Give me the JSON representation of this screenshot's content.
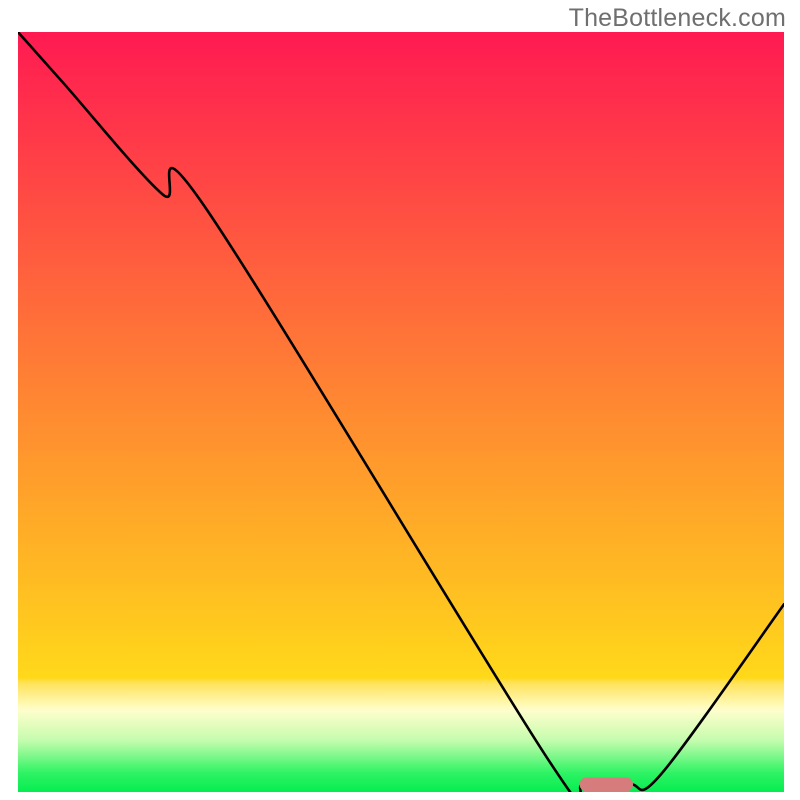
{
  "watermark": "TheBottleneck.com",
  "chart_data": {
    "type": "line",
    "title": "",
    "xlabel": "",
    "ylabel": "",
    "xlim": [
      0,
      10
    ],
    "ylim": [
      0,
      10
    ],
    "x": [
      0.0,
      0.6,
      1.88,
      2.46,
      6.9,
      7.38,
      7.98,
      8.4,
      10.0
    ],
    "y": [
      10.0,
      9.32,
      7.87,
      7.67,
      0.46,
      0.1,
      0.1,
      0.24,
      2.47
    ],
    "marker": {
      "x_center": 7.68,
      "y_center": 0.1,
      "width": 0.7,
      "height": 0.18,
      "color_hex": "#d77c7c"
    },
    "gradient_stops": [
      {
        "offset": 0.0,
        "color": "#ff1a52"
      },
      {
        "offset": 0.01,
        "color": "#ff1c51"
      },
      {
        "offset": 0.019,
        "color": "#ff1e51"
      },
      {
        "offset": 0.029,
        "color": "#ff2050"
      },
      {
        "offset": 0.039,
        "color": "#ff234f"
      },
      {
        "offset": 0.048,
        "color": "#ff254f"
      },
      {
        "offset": 0.058,
        "color": "#ff274e"
      },
      {
        "offset": 0.068,
        "color": "#ff294d"
      },
      {
        "offset": 0.077,
        "color": "#ff2b4d"
      },
      {
        "offset": 0.087,
        "color": "#ff2d4c"
      },
      {
        "offset": 0.097,
        "color": "#ff304c"
      },
      {
        "offset": 0.106,
        "color": "#ff324b"
      },
      {
        "offset": 0.116,
        "color": "#ff344a"
      },
      {
        "offset": 0.126,
        "color": "#ff364a"
      },
      {
        "offset": 0.135,
        "color": "#ff3849"
      },
      {
        "offset": 0.145,
        "color": "#ff3a48"
      },
      {
        "offset": 0.155,
        "color": "#ff3d48"
      },
      {
        "offset": 0.164,
        "color": "#ff3f47"
      },
      {
        "offset": 0.174,
        "color": "#ff4146"
      },
      {
        "offset": 0.184,
        "color": "#ff4346"
      },
      {
        "offset": 0.193,
        "color": "#ff4545"
      },
      {
        "offset": 0.203,
        "color": "#ff4745"
      },
      {
        "offset": 0.213,
        "color": "#ff4a44"
      },
      {
        "offset": 0.222,
        "color": "#ff4c43"
      },
      {
        "offset": 0.232,
        "color": "#ff4e43"
      },
      {
        "offset": 0.242,
        "color": "#ff5042"
      },
      {
        "offset": 0.251,
        "color": "#ff5241"
      },
      {
        "offset": 0.261,
        "color": "#ff5441"
      },
      {
        "offset": 0.271,
        "color": "#ff5740"
      },
      {
        "offset": 0.28,
        "color": "#ff593f"
      },
      {
        "offset": 0.29,
        "color": "#ff5b3f"
      },
      {
        "offset": 0.3,
        "color": "#ff5d3e"
      },
      {
        "offset": 0.309,
        "color": "#ff5f3e"
      },
      {
        "offset": 0.319,
        "color": "#ff613d"
      },
      {
        "offset": 0.329,
        "color": "#ff643c"
      },
      {
        "offset": 0.338,
        "color": "#ff663c"
      },
      {
        "offset": 0.348,
        "color": "#ff683b"
      },
      {
        "offset": 0.358,
        "color": "#ff6a3a"
      },
      {
        "offset": 0.367,
        "color": "#ff6c3a"
      },
      {
        "offset": 0.377,
        "color": "#ff6e39"
      },
      {
        "offset": 0.387,
        "color": "#ff7138"
      },
      {
        "offset": 0.396,
        "color": "#ff7338"
      },
      {
        "offset": 0.406,
        "color": "#ff7537"
      },
      {
        "offset": 0.415,
        "color": "#ff7737"
      },
      {
        "offset": 0.425,
        "color": "#ff7936"
      },
      {
        "offset": 0.435,
        "color": "#ff7b35"
      },
      {
        "offset": 0.444,
        "color": "#ff7e35"
      },
      {
        "offset": 0.454,
        "color": "#ff8034"
      },
      {
        "offset": 0.464,
        "color": "#ff8233"
      },
      {
        "offset": 0.473,
        "color": "#ff8433"
      },
      {
        "offset": 0.483,
        "color": "#ff8632"
      },
      {
        "offset": 0.493,
        "color": "#ff8831"
      },
      {
        "offset": 0.502,
        "color": "#ff8b31"
      },
      {
        "offset": 0.512,
        "color": "#ff8d30"
      },
      {
        "offset": 0.522,
        "color": "#ff8f30"
      },
      {
        "offset": 0.531,
        "color": "#ff912f"
      },
      {
        "offset": 0.541,
        "color": "#ff932e"
      },
      {
        "offset": 0.551,
        "color": "#ff952e"
      },
      {
        "offset": 0.56,
        "color": "#ff982d"
      },
      {
        "offset": 0.57,
        "color": "#ff9a2c"
      },
      {
        "offset": 0.58,
        "color": "#ff9c2c"
      },
      {
        "offset": 0.589,
        "color": "#ff9e2b"
      },
      {
        "offset": 0.599,
        "color": "#ffa02a"
      },
      {
        "offset": 0.609,
        "color": "#ffa22a"
      },
      {
        "offset": 0.618,
        "color": "#ffa529"
      },
      {
        "offset": 0.628,
        "color": "#ffa729"
      },
      {
        "offset": 0.638,
        "color": "#ffa928"
      },
      {
        "offset": 0.647,
        "color": "#ffab27"
      },
      {
        "offset": 0.657,
        "color": "#ffad27"
      },
      {
        "offset": 0.667,
        "color": "#ffaf26"
      },
      {
        "offset": 0.676,
        "color": "#ffb225"
      },
      {
        "offset": 0.686,
        "color": "#ffb425"
      },
      {
        "offset": 0.696,
        "color": "#ffb624"
      },
      {
        "offset": 0.705,
        "color": "#ffb823"
      },
      {
        "offset": 0.715,
        "color": "#ffba23"
      },
      {
        "offset": 0.725,
        "color": "#ffbc22"
      },
      {
        "offset": 0.734,
        "color": "#ffbf22"
      },
      {
        "offset": 0.744,
        "color": "#ffc121"
      },
      {
        "offset": 0.754,
        "color": "#ffc320"
      },
      {
        "offset": 0.763,
        "color": "#ffc520"
      },
      {
        "offset": 0.773,
        "color": "#ffc71f"
      },
      {
        "offset": 0.783,
        "color": "#ffc91e"
      },
      {
        "offset": 0.792,
        "color": "#ffcc1e"
      },
      {
        "offset": 0.802,
        "color": "#ffce1d"
      },
      {
        "offset": 0.812,
        "color": "#ffd01c"
      },
      {
        "offset": 0.821,
        "color": "#ffd21c"
      },
      {
        "offset": 0.831,
        "color": "#ffd41b"
      },
      {
        "offset": 0.841,
        "color": "#ffd61b"
      },
      {
        "offset": 0.85,
        "color": "#ffd91a"
      },
      {
        "offset": 0.855,
        "color": "#ffe050"
      },
      {
        "offset": 0.859,
        "color": "#ffe461"
      },
      {
        "offset": 0.864,
        "color": "#ffe872"
      },
      {
        "offset": 0.869,
        "color": "#ffec82"
      },
      {
        "offset": 0.874,
        "color": "#fff092"
      },
      {
        "offset": 0.879,
        "color": "#fff4a1"
      },
      {
        "offset": 0.884,
        "color": "#fff8b1"
      },
      {
        "offset": 0.888,
        "color": "#fffbc0"
      },
      {
        "offset": 0.893,
        "color": "#fdfecc"
      },
      {
        "offset": 0.898,
        "color": "#f6fec8"
      },
      {
        "offset": 0.903,
        "color": "#effec5"
      },
      {
        "offset": 0.908,
        "color": "#e8fdc1"
      },
      {
        "offset": 0.913,
        "color": "#e1fdbd"
      },
      {
        "offset": 0.917,
        "color": "#dafdb9"
      },
      {
        "offset": 0.922,
        "color": "#d3fdb5"
      },
      {
        "offset": 0.927,
        "color": "#ccfcb2"
      },
      {
        "offset": 0.932,
        "color": "#c5fcae"
      },
      {
        "offset": 0.937,
        "color": "#b4fba5"
      },
      {
        "offset": 0.942,
        "color": "#a3fa9d"
      },
      {
        "offset": 0.947,
        "color": "#92f994"
      },
      {
        "offset": 0.952,
        "color": "#81f88c"
      },
      {
        "offset": 0.957,
        "color": "#70f784"
      },
      {
        "offset": 0.961,
        "color": "#5ff67b"
      },
      {
        "offset": 0.966,
        "color": "#4ef573"
      },
      {
        "offset": 0.971,
        "color": "#3df46b"
      },
      {
        "offset": 0.976,
        "color": "#2cf263"
      },
      {
        "offset": 0.981,
        "color": "#24f15f"
      },
      {
        "offset": 0.986,
        "color": "#1cf05b"
      },
      {
        "offset": 0.991,
        "color": "#15ef58"
      },
      {
        "offset": 0.995,
        "color": "#0dee54"
      },
      {
        "offset": 1.0,
        "color": "#05ed51"
      }
    ]
  }
}
